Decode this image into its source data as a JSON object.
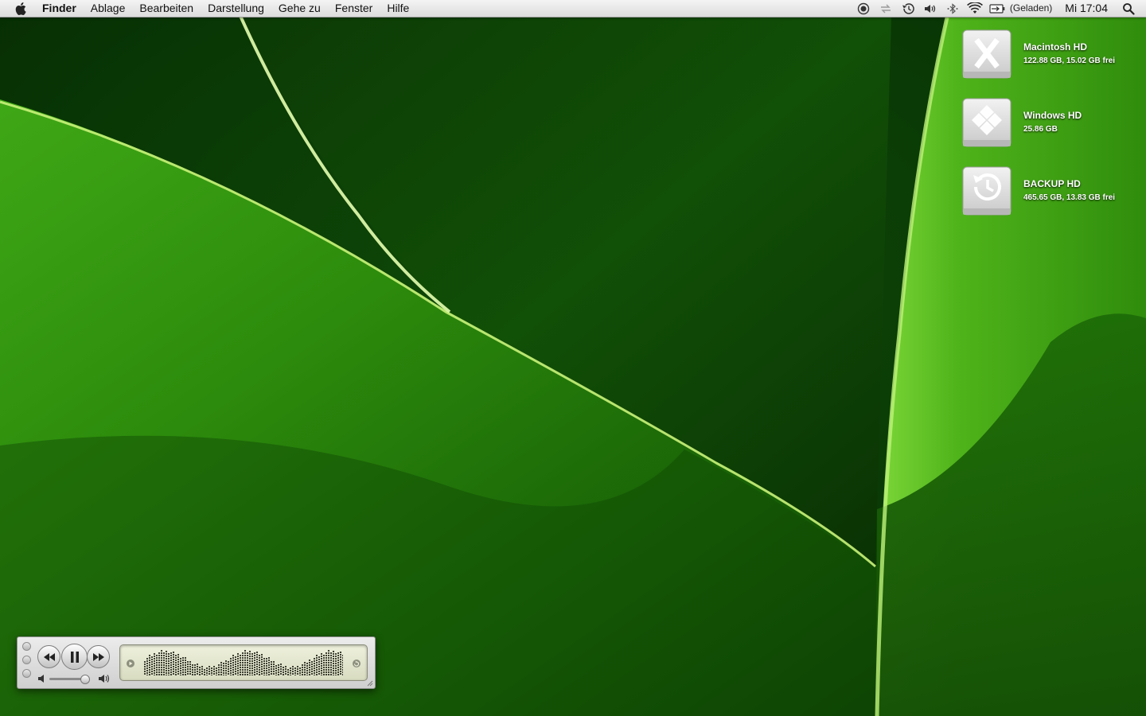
{
  "menubar": {
    "apple_menu_icon": "apple-icon",
    "app_name": "Finder",
    "menus": [
      "Ablage",
      "Bearbeiten",
      "Darstellung",
      "Gehe zu",
      "Fenster",
      "Hilfe"
    ],
    "status_icons": [
      "record-icon",
      "sync-icon",
      "time-machine-icon",
      "volume-icon",
      "bluetooth-icon",
      "wifi-icon",
      "battery-icon"
    ],
    "battery_status": "(Geladen)",
    "clock": "Mi 17:04",
    "spotlight_icon": "spotlight-search-icon"
  },
  "desktop": {
    "disks": [
      {
        "name": "Macintosh HD",
        "info": "122.88 GB, 15.02 GB frei",
        "icon": "macintosh-hd-icon"
      },
      {
        "name": "Windows HD",
        "info": "25.86 GB",
        "icon": "windows-hd-icon"
      },
      {
        "name": "BACKUP HD",
        "info": "465.65 GB, 13.83 GB frei",
        "icon": "backup-hd-icon"
      }
    ]
  },
  "mini_player": {
    "controls": [
      "previous-track-icon",
      "pause-icon",
      "next-track-icon"
    ],
    "volume_level": 0.9,
    "display": "equalizer-visualizer"
  },
  "colors": {
    "menubar": "#e8e8e8",
    "leaf_light": "#56c41e",
    "leaf_dark": "#0b3a05"
  }
}
